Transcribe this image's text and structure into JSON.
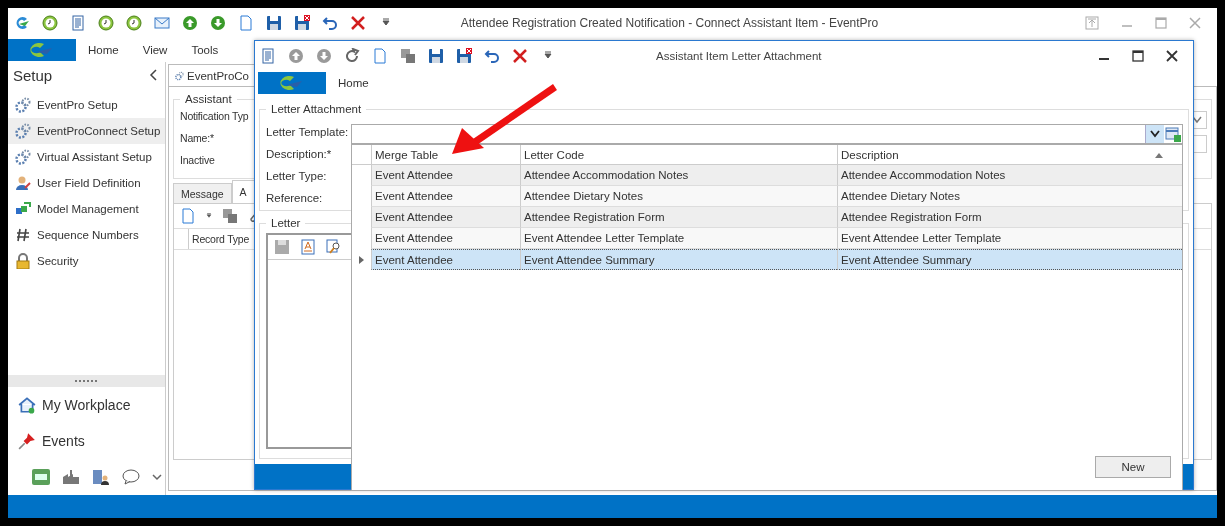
{
  "main_window": {
    "title": "Attendee Registration Created Notification - Connect Assistant Item - EventPro",
    "ribbon_tabs": [
      {
        "label": "Home"
      },
      {
        "label": "View"
      },
      {
        "label": "Tools"
      }
    ],
    "sidebar": {
      "title": "Setup",
      "items": [
        {
          "label": "EventPro Setup",
          "selected": false
        },
        {
          "label": "EventProConnect Setup",
          "selected": true
        },
        {
          "label": "Virtual Assistant Setup",
          "selected": false
        },
        {
          "label": "User Field Definition",
          "selected": false
        },
        {
          "label": "Model Management",
          "selected": false
        },
        {
          "label": "Sequence Numbers",
          "selected": false
        },
        {
          "label": "Security",
          "selected": false
        }
      ],
      "nav": [
        {
          "label": "My Workplace"
        },
        {
          "label": "Events"
        }
      ]
    },
    "document_tab": {
      "label": "EventProCo"
    },
    "assistant_group": {
      "title": "Assistant",
      "fields": [
        {
          "label": "Notification Typ"
        },
        {
          "label": "Name:*"
        },
        {
          "label": "Inactive"
        }
      ]
    },
    "detail_tabs": [
      {
        "label": "Message",
        "selected": false
      },
      {
        "label": "A",
        "selected": true
      }
    ],
    "grid": {
      "columns": [
        {
          "label": "Record Type"
        }
      ]
    }
  },
  "dialog": {
    "title": "Assistant Item Letter Attachment",
    "ribbon_tabs": [
      {
        "label": "Home"
      }
    ],
    "letter_attachment": {
      "title": "Letter Attachment",
      "fields": [
        {
          "label": "Letter Template:"
        },
        {
          "label": "Description:*"
        },
        {
          "label": "Letter Type:"
        },
        {
          "label": "Reference:"
        }
      ]
    },
    "letter_group": {
      "title": "Letter"
    },
    "lookup": {
      "columns": [
        {
          "label": "Merge Table"
        },
        {
          "label": "Letter Code"
        },
        {
          "label": "Description"
        }
      ],
      "rows": [
        {
          "cells": [
            "Event Attendee",
            "Attendee Accommodation Notes",
            "Attendee Accommodation Notes"
          ],
          "selected": false
        },
        {
          "cells": [
            "Event Attendee",
            "Attendee Dietary Notes",
            "Attendee Dietary Notes"
          ],
          "selected": false
        },
        {
          "cells": [
            "Event Attendee",
            "Attendee Registration Form",
            "Attendee Registration Form"
          ],
          "selected": false
        },
        {
          "cells": [
            "Event Attendee",
            "Event Attendee Letter Template",
            "Event Attendee Letter Template"
          ],
          "selected": false
        },
        {
          "cells": [
            "Event Attendee",
            "Event Attendee Summary",
            "Event Attendee Summary"
          ],
          "selected": true
        }
      ],
      "new_button": "New"
    }
  }
}
